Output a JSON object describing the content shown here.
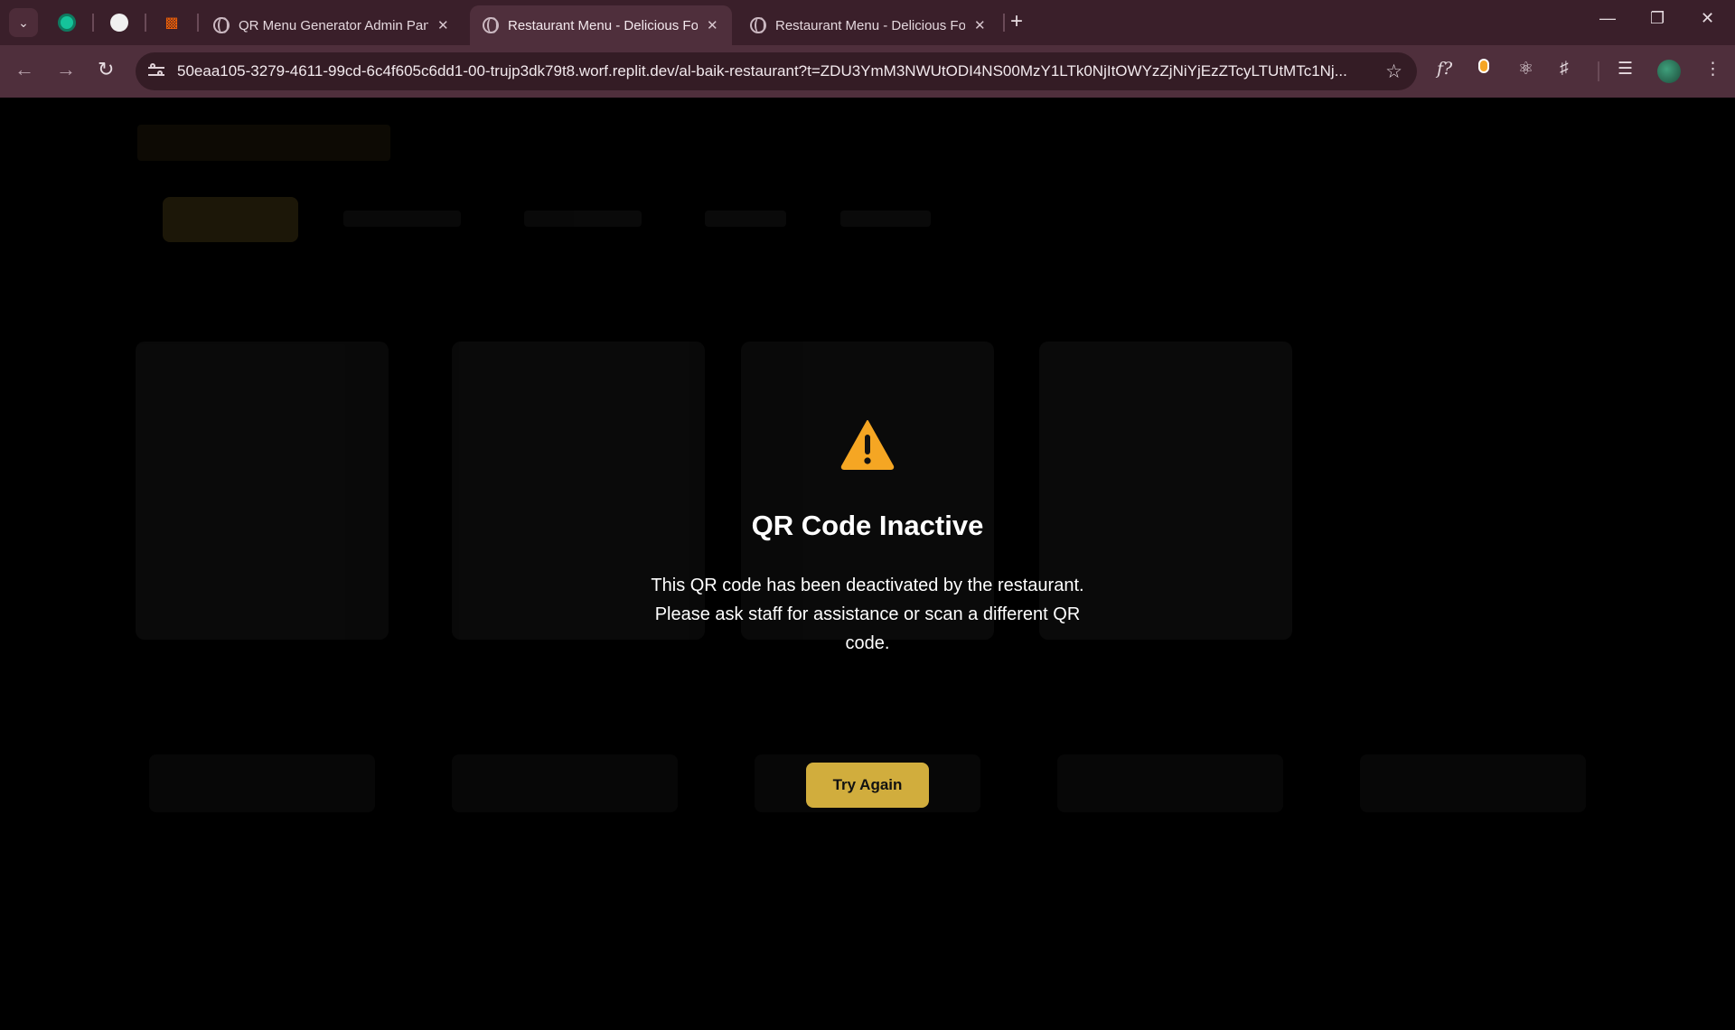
{
  "browser": {
    "tabs": [
      {
        "title": "QR Menu Generator Admin Panel"
      },
      {
        "title": "Restaurant Menu - Delicious Food"
      },
      {
        "title": "Restaurant Menu - Delicious Food"
      }
    ],
    "new_tab_symbol": "+",
    "url": "50eaa105-3279-4611-99cd-6c4f605c6dd1-00-trujp3dk79t8.worf.replit.dev/al-baik-restaurant?t=ZDU3YmM3NWUtODI4NS00MzY1LTk0NjItOWYzZjNiYjEzZTcyLTUtMTc1Nj...",
    "extension_label": "f?"
  },
  "notice": {
    "icon": "warning-triangle-icon",
    "title": "QR Code Inactive",
    "message": "This QR code has been deactivated by the restaurant. Please ask staff for assistance or scan a different QR code.",
    "button_label": "Try Again"
  },
  "colors": {
    "accent": "#d1ad3d",
    "warning": "#f5a623",
    "background": "#000000"
  }
}
